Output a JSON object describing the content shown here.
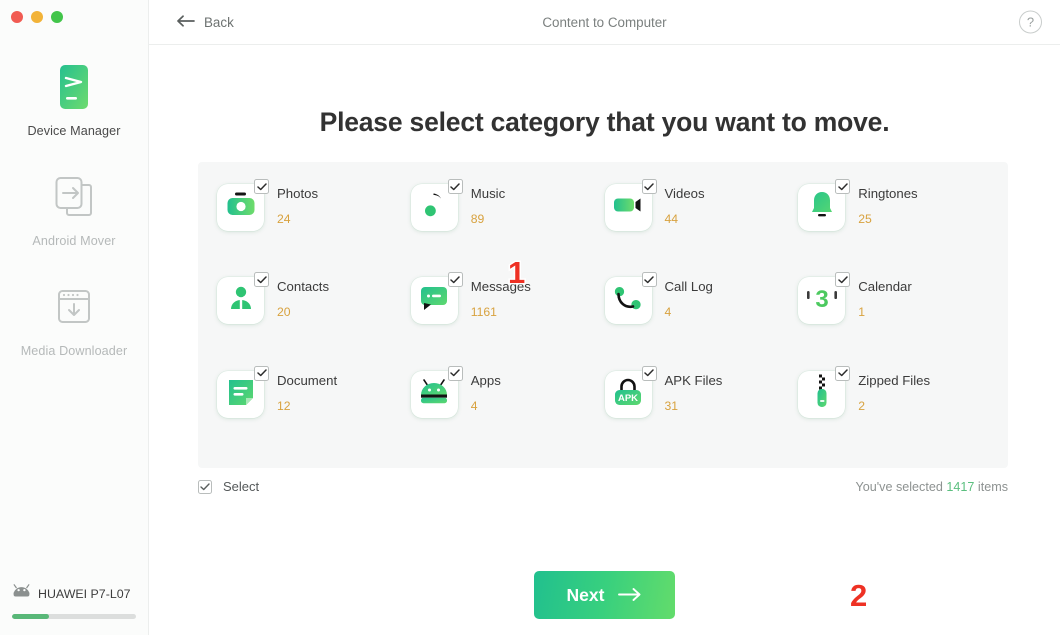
{
  "window": {
    "traffic_lights": [
      "close",
      "minimize",
      "maximize"
    ],
    "colors": {
      "red": "#f15b52",
      "yellow": "#f2b338",
      "green": "#42c54a"
    }
  },
  "sidebar": {
    "items": [
      {
        "label": "Device Manager",
        "icon": "device-manager-icon",
        "active": true
      },
      {
        "label": "Android Mover",
        "icon": "android-mover-icon",
        "active": false
      },
      {
        "label": "Media Downloader",
        "icon": "media-downloader-icon",
        "active": false
      }
    ],
    "device": {
      "name": "HUAWEI P7-L07",
      "icon": "android-robot-icon",
      "storage_percent": 30
    }
  },
  "header": {
    "back_label": "Back",
    "back_icon": "arrow-left-icon",
    "title": "Content to Computer",
    "help_icon": "question-mark-icon",
    "help_label": "?"
  },
  "main": {
    "headline": "Please select category that you want to move.",
    "categories": [
      {
        "name": "Photos",
        "count": "24",
        "icon": "camera-icon",
        "checked": true
      },
      {
        "name": "Music",
        "count": "89",
        "icon": "music-note-icon",
        "checked": true
      },
      {
        "name": "Videos",
        "count": "44",
        "icon": "video-camera-icon",
        "checked": true
      },
      {
        "name": "Ringtones",
        "count": "25",
        "icon": "bell-icon",
        "checked": true
      },
      {
        "name": "Contacts",
        "count": "20",
        "icon": "contact-person-icon",
        "checked": true
      },
      {
        "name": "Messages",
        "count": "1161",
        "icon": "chat-bubble-icon",
        "checked": true
      },
      {
        "name": "Call Log",
        "count": "4",
        "icon": "phone-handset-icon",
        "checked": true
      },
      {
        "name": "Calendar",
        "count": "1",
        "icon": "calendar-icon",
        "checked": true
      },
      {
        "name": "Document",
        "count": "12",
        "icon": "document-icon",
        "checked": true
      },
      {
        "name": "Apps",
        "count": "4",
        "icon": "android-apps-icon",
        "checked": true
      },
      {
        "name": "APK Files",
        "count": "31",
        "icon": "apk-bag-icon",
        "checked": true
      },
      {
        "name": "Zipped Files",
        "count": "2",
        "icon": "zip-file-icon",
        "checked": true
      }
    ],
    "select_all": {
      "label": "Select",
      "checked": true
    },
    "selection_info": {
      "prefix": "You've selected ",
      "count": "1417",
      "suffix": " items"
    },
    "next_button": {
      "label": "Next",
      "icon": "arrow-right-icon"
    },
    "annotations": [
      {
        "label": "1"
      },
      {
        "label": "2"
      }
    ]
  },
  "colors": {
    "accent_green": "#5bbf7f",
    "count_amber": "#d8a23f",
    "annotation_red": "#ee3124",
    "panel_bg": "#f6f7f7"
  }
}
